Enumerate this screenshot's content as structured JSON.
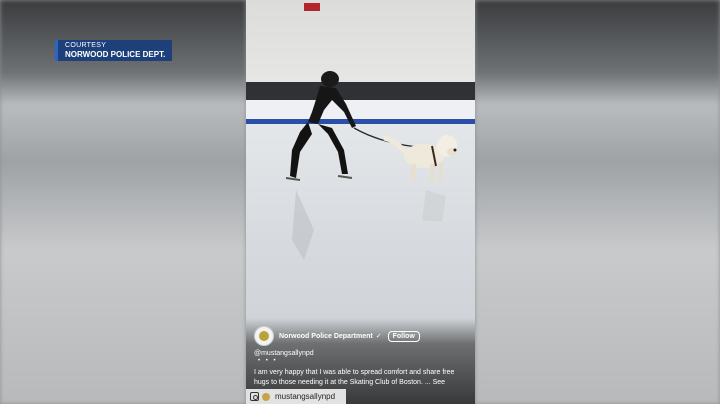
{
  "overlay": {
    "courtesy_label": "COURTESY",
    "courtesy_source": "NORWOOD POLICE DEPT."
  },
  "post": {
    "account_name": "Norwood Police Department",
    "verified_icon": "verified-check-icon",
    "follow_label": "Follow",
    "handle": "@mustangsallynpd",
    "dots": "• • •",
    "text": "I am very happy that I was able to spread comfort and share free hugs to those needing it at the Skating Club of Boston. ... See"
  },
  "instagram_bar": {
    "icon": "instagram-icon",
    "handle": "mustangsallynpd"
  },
  "colors": {
    "courtesy_bg": "#1d3f7a",
    "rink_rail": "#2b4fa8",
    "exit_sign": "#b3262c"
  }
}
